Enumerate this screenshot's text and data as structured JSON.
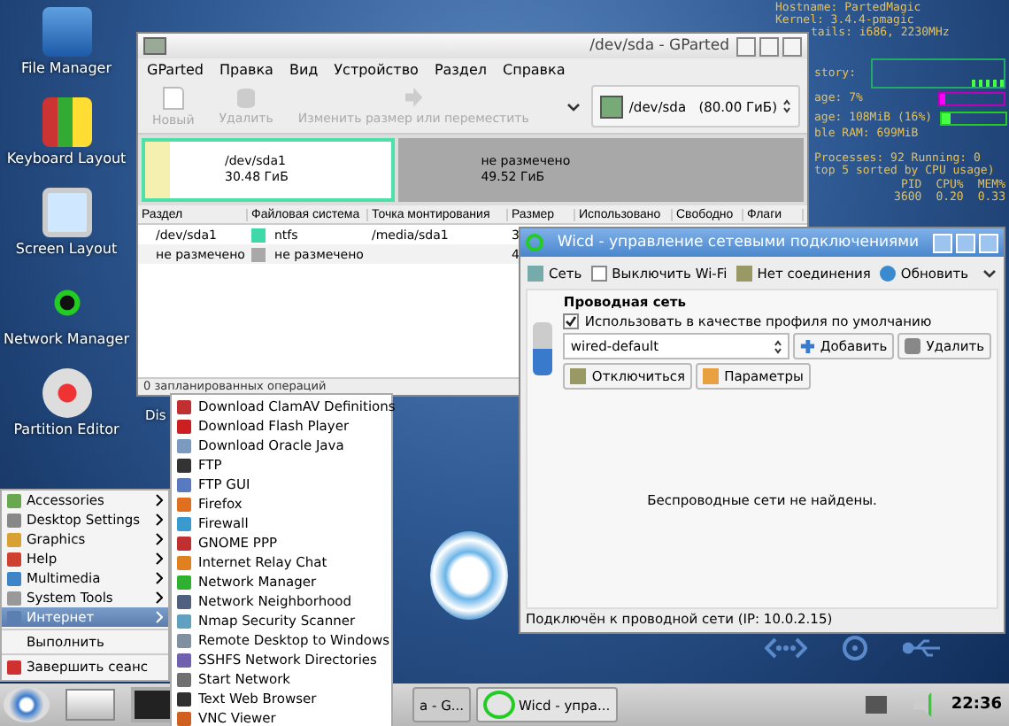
{
  "desktop_icons": [
    {
      "label": "File Manager"
    },
    {
      "label": "Keyboard Layout"
    },
    {
      "label": "Screen Layout"
    },
    {
      "label": "Network Manager"
    },
    {
      "label": "Partition Editor"
    }
  ],
  "desktop_cut_label": "Dis",
  "conky": {
    "header": [
      "Hostname: PartedMagic",
      "Kernel: 3.4.4-pmagic",
      "tails: i686, 2230MHz"
    ],
    "history_label": "story:",
    "cpu_label": "age: 7%",
    "cpu": {
      "level": 0.07
    },
    "ram_label": "age: 108MiB (16%)",
    "ram": {
      "level": 0.16
    },
    "ram_free": "ble RAM: 699MiB",
    "processes": "Processes: 92  Running: 0",
    "sorted": "top 5 sorted by CPU usage)",
    "columns": [
      "PID",
      "CPU%",
      "MEM%"
    ],
    "row": [
      "3600",
      "0.20",
      "0.33"
    ]
  },
  "gparted": {
    "title": "/dev/sda - GParted",
    "menu": [
      "GParted",
      "Правка",
      "Вид",
      "Устройство",
      "Раздел",
      "Справка"
    ],
    "toolbar": [
      {
        "label": "Новый",
        "disabled": true,
        "kind": "new"
      },
      {
        "label": "Удалить",
        "disabled": true,
        "kind": "delete"
      },
      {
        "label": "Изменить размер или переместить",
        "disabled": true,
        "kind": "resize"
      }
    ],
    "device": "/dev/sda",
    "device_size": "(80.00 ГиБ)",
    "partitions": [
      {
        "name": "/dev/sda1",
        "size": "30.48 ГиБ",
        "selected": true,
        "kind": "ntfs",
        "level": 0.1
      },
      {
        "name": "не размечено",
        "size": "49.52 ГиБ",
        "selected": false,
        "kind": "unallocated"
      }
    ],
    "columns": [
      "Раздел",
      "Файловая система",
      "Точка монтирования",
      "Размер",
      "Использовано",
      "Свободно",
      "Флаги"
    ],
    "rows": [
      {
        "partition": "/dev/sda1",
        "color": "#3fd8a8",
        "filesystem": "ntfs",
        "mount": "/media/sda1",
        "size": "3"
      },
      {
        "partition": "не размечено",
        "color": "#a8a8a8",
        "filesystem": "не размечено",
        "mount": "",
        "size": "4"
      }
    ],
    "status": "0 запланированных операций"
  },
  "wicd": {
    "title": "Wicd - управление сетевыми подключениями",
    "toolbar": {
      "network": "Сеть",
      "wifi_off": {
        "label": "Выключить Wi-Fi",
        "checked": false
      },
      "connection": "Нет соединения",
      "refresh": "Обновить"
    },
    "wired_heading": "Проводная сеть",
    "default_profile": {
      "label": "Использовать в качестве профиля по умолчанию",
      "checked": true
    },
    "profile": "wired-default",
    "add": "Добавить",
    "remove": "Удалить",
    "disconnect": "Отключиться",
    "settings": "Параметры",
    "message": "Беспроводные сети не найдены.",
    "status": "Подключён к проводной сети (IP: 10.0.2.15)"
  },
  "start_menu": {
    "items": [
      {
        "label": "Accessories",
        "selected": false,
        "color": "#6aa84f"
      },
      {
        "label": "Desktop Settings",
        "selected": false,
        "color": "#888888"
      },
      {
        "label": "Graphics",
        "selected": false,
        "color": "#d9a032"
      },
      {
        "label": "Help",
        "selected": false,
        "color": "#d04030"
      },
      {
        "label": "Multimedia",
        "selected": false,
        "color": "#3d85c6"
      },
      {
        "label": "System Tools",
        "selected": false,
        "color": "#999999"
      },
      {
        "label": "Интернет",
        "selected": true,
        "color": "#5b7fb0"
      }
    ],
    "run": "Выполнить",
    "logout": "Завершить сеанс"
  },
  "submenu": [
    {
      "label": "Download ClamAV Definitions",
      "color": "#c03030"
    },
    {
      "label": "Download Flash Player",
      "color": "#cc2020"
    },
    {
      "label": "Download Oracle Java",
      "color": "#7a9ac0"
    },
    {
      "label": "FTP",
      "color": "#333333"
    },
    {
      "label": "FTP GUI",
      "color": "#5a7ac0"
    },
    {
      "label": "Firefox",
      "color": "#e07020"
    },
    {
      "label": "Firewall",
      "color": "#3a9ad0"
    },
    {
      "label": "GNOME PPP",
      "color": "#c03030"
    },
    {
      "label": "Internet Relay Chat",
      "color": "#e08020"
    },
    {
      "label": "Network Manager",
      "color": "#30b030"
    },
    {
      "label": "Network Neighborhood",
      "color": "#506080"
    },
    {
      "label": "Nmap Security Scanner",
      "color": "#60a0c0"
    },
    {
      "label": "Remote Desktop to Windows",
      "color": "#8090a0"
    },
    {
      "label": "SSHFS Network Directories",
      "color": "#7060b0"
    },
    {
      "label": "Start Network",
      "color": "#707070"
    },
    {
      "label": "Text Web Browser",
      "color": "#303030"
    },
    {
      "label": "VNC Viewer",
      "color": "#d06020"
    }
  ],
  "taskbar": {
    "tasks": [
      {
        "label": "a - G...",
        "selected": false
      },
      {
        "label": "Wicd - упра...",
        "selected": true
      }
    ],
    "clock": "22:36"
  }
}
